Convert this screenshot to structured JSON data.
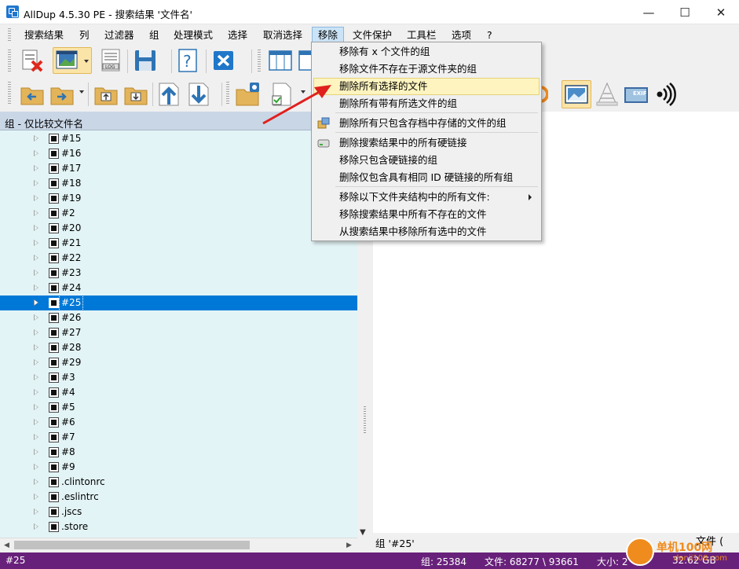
{
  "window": {
    "title": "AllDup 4.5.30 PE - 搜索结果 '文件名'",
    "minimize": "—",
    "maximize": "☐",
    "close": "✕"
  },
  "menubar": [
    "搜索结果",
    "列",
    "过滤器",
    "组",
    "处理模式",
    "选择",
    "取消选择",
    "移除",
    "文件保护",
    "工具栏",
    "选项",
    "?"
  ],
  "open_menu": "移除",
  "dropdown": {
    "items": [
      {
        "label": "移除有 x 个文件的组",
        "icon": ""
      },
      {
        "label": "移除文件不存在于源文件夹的组",
        "icon": ""
      },
      {
        "label": "删除所有选择的文件",
        "icon": "",
        "highlighted": true
      },
      {
        "label": "删除所有带有所选文件的组",
        "icon": ""
      },
      {
        "label": "删除所有只包含存档中存储的文件的组",
        "icon": "archive-icon"
      },
      {
        "label": "删除搜索结果中的所有硬链接",
        "icon": "drive-icon"
      },
      {
        "label": "移除只包含硬链接的组",
        "icon": ""
      },
      {
        "label": "删除仅包含具有相同 ID 硬链接的所有组",
        "icon": ""
      },
      {
        "label": "移除以下文件夹结构中的所有文件:",
        "icon": "",
        "submenu": true
      },
      {
        "label": "移除搜索结果中所有不存在的文件",
        "icon": ""
      },
      {
        "label": "从搜索结果中移除所有选中的文件",
        "icon": ""
      }
    ]
  },
  "tree": {
    "header": "组 - 仅比较文件名",
    "rows": [
      "#15",
      "#16",
      "#17",
      "#18",
      "#19",
      "#2",
      "#20",
      "#21",
      "#22",
      "#23",
      "#24",
      "#25",
      "#26",
      "#27",
      "#28",
      "#29",
      "#3",
      "#4",
      "#5",
      "#6",
      "#7",
      "#8",
      "#9",
      ".clintonrc",
      ".eslintrc",
      ".jscs",
      ".store"
    ],
    "selected": "#25"
  },
  "right_pane": {
    "group_label": "组 '#25'",
    "files_label": "文件 ("
  },
  "status": {
    "left": "#25",
    "groups": "组: 25384",
    "files": "文件: 68277 \\ 93661",
    "size": "大小: 2",
    "size_tail": "32.62 GB"
  },
  "watermark": {
    "text": "单机100网",
    "sub": "danji100.com"
  },
  "colors": {
    "status_bg": "#68217a",
    "tree_bg": "#e3f4f6",
    "selection": "#0078d7",
    "menu_highlight": "#fdf4bf",
    "header_bg": "#c9d6e6"
  }
}
